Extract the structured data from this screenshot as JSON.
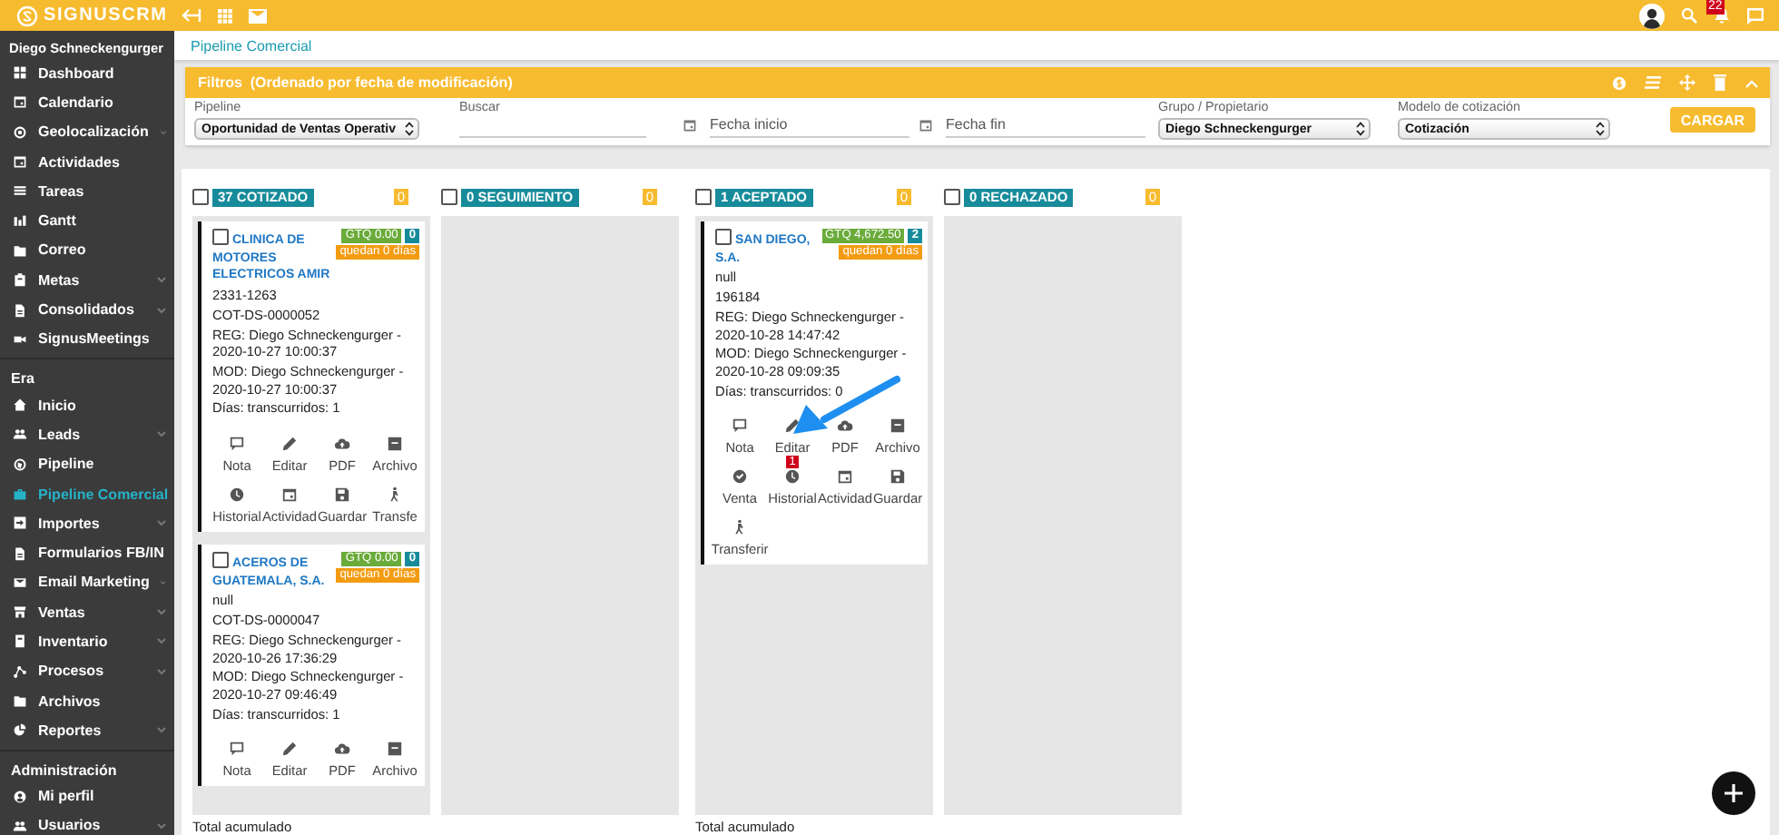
{
  "brand": {
    "name": "SIGNUSCRM"
  },
  "topbar": {
    "notification_count": "22"
  },
  "sidebar": {
    "user": "Diego Schneckengurger",
    "groups": [
      {
        "items": [
          {
            "label": "Dashboard",
            "expandable": false,
            "selected": false
          },
          {
            "label": "Calendario",
            "expandable": false,
            "selected": false
          },
          {
            "label": "Geolocalización",
            "expandable": true,
            "selected": false
          },
          {
            "label": "Actividades",
            "expandable": false,
            "selected": false
          },
          {
            "label": "Tareas",
            "expandable": false,
            "selected": false
          },
          {
            "label": "Gantt",
            "expandable": false,
            "selected": false
          },
          {
            "label": "Correo",
            "expandable": false,
            "selected": false
          },
          {
            "label": "Metas",
            "expandable": true,
            "selected": false
          },
          {
            "label": "Consolidados",
            "expandable": true,
            "selected": false
          },
          {
            "label": "SignusMeetings",
            "expandable": false,
            "selected": false
          }
        ]
      },
      {
        "title": "Era",
        "items": [
          {
            "label": "Inicio",
            "expandable": false,
            "selected": false
          },
          {
            "label": "Leads",
            "expandable": true,
            "selected": false
          },
          {
            "label": "Pipeline",
            "expandable": false,
            "selected": false
          },
          {
            "label": "Pipeline Comercial",
            "expandable": false,
            "selected": true
          },
          {
            "label": "Importes",
            "expandable": true,
            "selected": false
          },
          {
            "label": "Formularios FB/IN",
            "expandable": false,
            "selected": false
          },
          {
            "label": "Email Marketing",
            "expandable": true,
            "selected": false
          },
          {
            "label": "Ventas",
            "expandable": true,
            "selected": false
          },
          {
            "label": "Inventario",
            "expandable": true,
            "selected": false
          },
          {
            "label": "Procesos",
            "expandable": true,
            "selected": false
          },
          {
            "label": "Archivos",
            "expandable": false,
            "selected": false
          },
          {
            "label": "Reportes",
            "expandable": true,
            "selected": false
          }
        ]
      },
      {
        "title": "Administración",
        "items": [
          {
            "label": "Mi perfil",
            "expandable": false,
            "selected": false
          },
          {
            "label": "Usuarios",
            "expandable": true,
            "selected": false
          }
        ]
      }
    ]
  },
  "breadcrumb": "Pipeline Comercial",
  "filters": {
    "title": "Filtros  (Ordenado por fecha de modificación)",
    "fields": [
      {
        "kind": "select",
        "label": "Pipeline",
        "value": "Oportunidad de Ventas Operativ"
      },
      {
        "kind": "text",
        "label": "Buscar"
      },
      {
        "kind": "date",
        "placeholder": "Fecha inicio"
      },
      {
        "kind": "date",
        "placeholder": "Fecha fin"
      },
      {
        "kind": "select",
        "label": "Grupo / Propietario",
        "value": "Diego Schneckengurger"
      },
      {
        "kind": "select",
        "label": "Modelo de cotización",
        "value": "Cotización"
      }
    ],
    "button": "CARGAR"
  },
  "board": {
    "columns": [
      {
        "title": "37 COTIZADO",
        "count": "0",
        "checked": false,
        "footer": "Total acumulado",
        "cards": [
          {
            "name": "CLINICA DE MOTORES ELECTRICOS AMIR",
            "amount": "GTQ 0.00",
            "number": "0",
            "remaining": "quedan 0 días",
            "checked": false,
            "lines": [
              "2331-1263",
              "COT-DS-0000052",
              "REG: Diego Schneckengurger - 2020-10-27 10:00:37",
              "MOD: Diego Schneckengurger - 2020-10-27 10:00:37",
              "Días: transcurridos: 1"
            ],
            "actions": [
              {
                "label": "Nota",
                "kind": "note"
              },
              {
                "label": "Editar",
                "kind": "edit"
              },
              {
                "label": "PDF",
                "kind": "pdf"
              },
              {
                "label": "Archivo",
                "kind": "file"
              },
              {
                "label": "Historial",
                "kind": "history"
              },
              {
                "label": "Actividad",
                "kind": "activity"
              },
              {
                "label": "Guardar",
                "kind": "save"
              },
              {
                "label": "Transfe",
                "kind": "transfer"
              }
            ]
          },
          {
            "name": "ACEROS DE GUATEMALA, S.A.",
            "amount": "GTQ 0.00",
            "number": "0",
            "remaining": "quedan 0 días",
            "checked": false,
            "lines": [
              "null",
              "COT-DS-0000047",
              "REG: Diego Schneckengurger - 2020-10-26 17:36:29",
              "MOD: Diego Schneckengurger - 2020-10-27 09:46:49",
              "Días: transcurridos: 1"
            ],
            "actions": [
              {
                "label": "Nota",
                "kind": "note"
              },
              {
                "label": "Editar",
                "kind": "edit"
              },
              {
                "label": "PDF",
                "kind": "pdf"
              },
              {
                "label": "Archivo",
                "kind": "file"
              }
            ]
          }
        ]
      },
      {
        "title": "0 SEGUIMIENTO",
        "count": "0",
        "checked": false
      },
      {
        "title": "1 ACEPTADO",
        "count": "0",
        "checked": false,
        "footer": "Total acumulado",
        "cards": [
          {
            "name": "SAN DIEGO, S.A.",
            "amount": "GTQ 4,672.50",
            "number": "2",
            "remaining": "quedan 0 días",
            "checked": false,
            "lines": [
              "null",
              "196184",
              "REG: Diego Schneckengurger - 2020-10-28 14:47:42",
              "MOD: Diego Schneckengurger - 2020-10-28 09:09:35",
              "Días: transcurridos: 0"
            ],
            "actions": [
              {
                "label": "Nota",
                "kind": "note"
              },
              {
                "label": "Editar",
                "kind": "edit",
                "badge": "1"
              },
              {
                "label": "PDF",
                "kind": "pdf"
              },
              {
                "label": "Archivo",
                "kind": "file"
              },
              {
                "label": "Venta",
                "kind": "sale"
              },
              {
                "label": "Historial",
                "kind": "history"
              },
              {
                "label": "Actividad",
                "kind": "activity"
              },
              {
                "label": "Guardar",
                "kind": "save"
              },
              {
                "label": "Transferir",
                "kind": "transfer"
              }
            ]
          }
        ]
      },
      {
        "title": "0 RECHAZADO",
        "count": "0",
        "checked": false
      }
    ]
  }
}
